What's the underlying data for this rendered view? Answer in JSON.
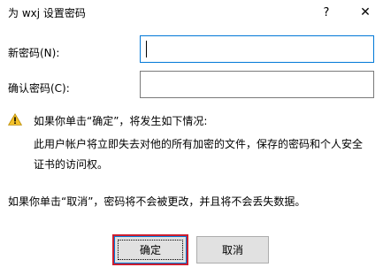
{
  "window": {
    "title": "为 wxj 设置密码",
    "help_glyph": "?",
    "close_glyph": "✕"
  },
  "form": {
    "new_password_label": "新密码(N):",
    "new_password_value": "",
    "confirm_password_label": "确认密码(C):",
    "confirm_password_value": ""
  },
  "warning": {
    "icon": "warning-triangle-icon",
    "heading": "如果你单击“确定”，将发生如下情况:",
    "detail": "此用户帐户将立即失去对他的所有加密的文件，保存的密码和个人安全证书的访问权。"
  },
  "cancel_note": "如果你单击“取消”，密码将不会被更改，并且将不会丢失数据。",
  "buttons": {
    "ok_label": "确定",
    "cancel_label": "取消"
  },
  "colors": {
    "focus_border": "#0078d7",
    "highlight_box": "#cc1e2f",
    "warning_yellow": "#f4c22b",
    "button_face": "#e1e1e1"
  }
}
